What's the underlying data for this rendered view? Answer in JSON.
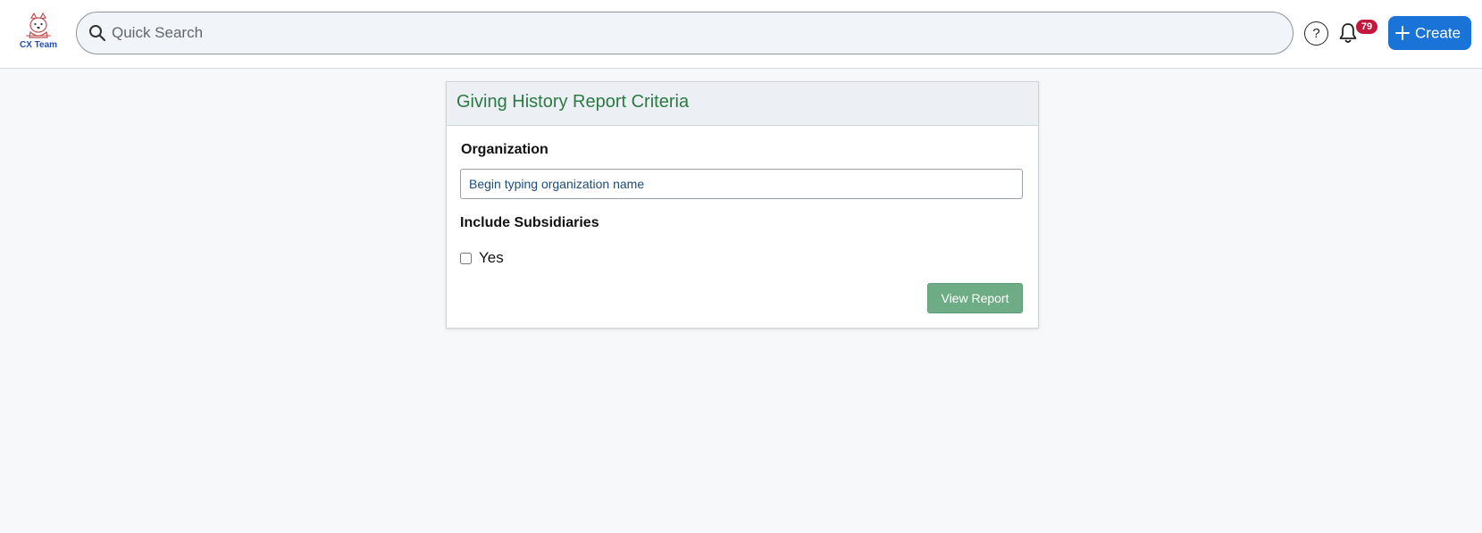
{
  "header": {
    "logo_text": "CX Team",
    "search": {
      "placeholder": "Quick Search",
      "value": ""
    },
    "help_label": "?",
    "notifications_count": "79",
    "create_label": "Create",
    "colors": {
      "primary": "#1a73d6",
      "badge": "#c4173e"
    }
  },
  "report": {
    "title": "Giving History Report Criteria",
    "organization_label": "Organization",
    "organization_input": {
      "placeholder": "Begin typing organization name",
      "value": ""
    },
    "subsidiaries_label": "Include Subsidiaries",
    "subsidiaries_option": "Yes",
    "subsidiaries_checked": false,
    "view_button": "View Report",
    "colors": {
      "title": "#2b7a43",
      "button": "#6eac86"
    }
  },
  "icons": [
    "dog-logo-icon",
    "search-icon",
    "help-icon",
    "bell-icon",
    "plus-icon"
  ]
}
